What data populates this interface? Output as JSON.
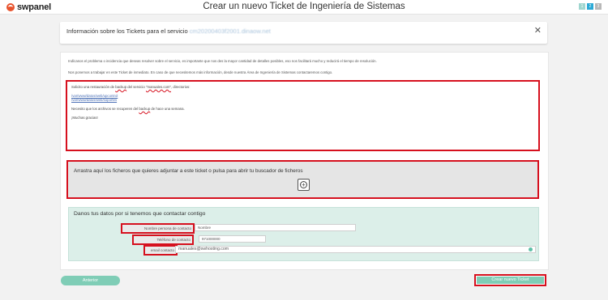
{
  "header": {
    "logo_text": "swpanel",
    "title": "Crear un nuevo Ticket de Ingeniería de Sistemas",
    "steps": [
      "1",
      "2",
      "3"
    ]
  },
  "info": {
    "title": "Información sobre los Tickets para el servicio",
    "service": "cm20200403f2001.dinaow.net",
    "close": "✕"
  },
  "intro": {
    "line1": "Indícanos el problema o incidencia que deseas resolver sobre el servicio, es importante que nos des la mayor cantidad de detalles posibles, eso nos facilitará mucho y reducirá el tiempo de resolución.",
    "line2": "Nos ponemos a trabajar en este Ticket de inmediato. En caso de que necesitemos más información, desde nuestra Área de Ingeniería de Sistemas contactaremos contigo."
  },
  "ticket": {
    "line1_pre": "Solicito una restauración de ",
    "line1_word": "backup",
    "line1_mid": " del servicio ",
    "line1_service": "\"manuales.com\"",
    "line1_post": ", directorios:",
    "path1": "/var/www/datos/web/upcontrol",
    "path2": "/var/www/datos/web/soportes",
    "line3_pre": "Necesito que los archivos se recuperen del ",
    "line3_word": "backup",
    "line3_post": " de hace una semana.",
    "thanks": "¡Muchas gracias!"
  },
  "dropzone": {
    "text": "Arrastra aquí los ficheros que quieres adjuntar a este ticket o pulsa para abrir tu buscador de ficheros",
    "button": "+"
  },
  "contact": {
    "title": "Danos tus datos por si tenemos que contactar contigo",
    "name_label": "Nombre persona de contacto",
    "name_value": "Nombre",
    "phone_label": "Teléfono de contacto",
    "phone_value": "971000000",
    "email_label": "email contacto",
    "email_value": "manuales@swhosting.com"
  },
  "actions": {
    "back": "Anterior",
    "create": "Crear nuevo Ticket"
  },
  "colors": {
    "accent": "#7fcdb6",
    "highlight": "#d6101e",
    "brand": "#e8532d"
  }
}
